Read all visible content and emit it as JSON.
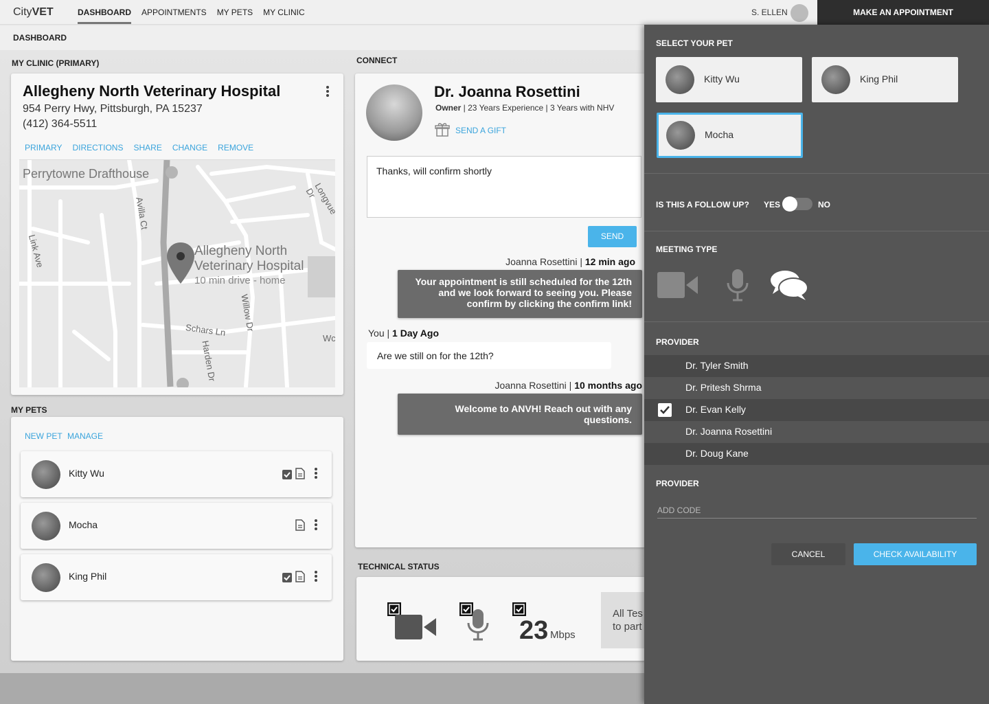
{
  "app": {
    "logo_light": "City",
    "logo_bold": "VET"
  },
  "nav": {
    "items": [
      "DASHBOARD",
      "APPOINTMENTS",
      "MY PETS",
      "MY CLINIC"
    ]
  },
  "user": {
    "name": "S. ELLEN"
  },
  "header": {
    "cta": "MAKE AN APPOINTMENT"
  },
  "breadcrumb": "DASHBOARD",
  "clinic": {
    "section": "MY CLINIC (PRIMARY)",
    "name": "Allegheny North Veterinary Hospital",
    "address": "954 Perry Hwy, Pittsburgh, PA 15237",
    "phone": "(412) 364-5511",
    "actions": [
      "PRIMARY",
      "DIRECTIONS",
      "SHARE",
      "CHANGE",
      "REMOVE"
    ],
    "map": {
      "poi": "Perrytowne Drafthouse",
      "pin_title_1": "Allegheny North",
      "pin_title_2": "Veterinary Hospital",
      "pin_sub": "10 min drive - home",
      "streets": [
        "Avilla Ct",
        "Link Ave",
        "Longvue Dr",
        "Schars Ln",
        "Willow Dr",
        "Harden Dr",
        "Wc"
      ]
    }
  },
  "pets": {
    "section": "MY PETS",
    "new_label": "NEW PET",
    "manage_label": "MANAGE",
    "items": [
      {
        "name": "Kitty Wu"
      },
      {
        "name": "Mocha"
      },
      {
        "name": "King Phil"
      }
    ]
  },
  "connect": {
    "section": "CONNECT",
    "doctor": "Dr. Joanna Rosettini",
    "role": "Owner",
    "meta": " | 23 Years Experience | 3 Years with NHV",
    "gift": "SEND A GIFT",
    "draft": "Thanks, will confirm shortly",
    "send": "SEND",
    "messages": [
      {
        "from": "Joanna Rosettini | ",
        "time": "12 min ago",
        "text": "Your appointment is still scheduled for the 12th and we look forward to seeing you. Please confirm by clicking the confirm link!"
      },
      {
        "from": "You | ",
        "time": "1 Day Ago",
        "text": "Are we still on for the 12th?"
      },
      {
        "from": "Joanna Rosettini | ",
        "time": "10 months ago",
        "text": "Welcome to ANVH! Reach out with any questions."
      }
    ]
  },
  "tech": {
    "section": "TECHNICAL STATUS",
    "speed": "23",
    "unit": "Mbps",
    "tests_line1": "All Tes",
    "tests_line2": "to part"
  },
  "appointment_panel": {
    "select_pet": "SELECT YOUR PET",
    "pets": [
      "Kitty Wu",
      "King Phil",
      "Mocha"
    ],
    "selected_pet": "Mocha",
    "follow_up_q": "IS THIS A FOLLOW UP?",
    "yes": "YES",
    "no": "NO",
    "meeting_type": "MEETING TYPE",
    "provider_label": "PROVIDER",
    "providers": [
      "Dr. Tyler Smith",
      "Dr. Pritesh Shrma",
      "Dr. Evan Kelly",
      "Dr. Joanna Rosettini",
      "Dr. Doug Kane"
    ],
    "selected_provider": "Dr. Evan Kelly",
    "code_label": "PROVIDER",
    "code_placeholder": "ADD CODE",
    "cancel": "CANCEL",
    "check": "CHECK AVAILABILITY"
  },
  "colors": {
    "accent": "#4ab4ea",
    "panel": "#555555",
    "bubble": "#6b6b6b"
  }
}
